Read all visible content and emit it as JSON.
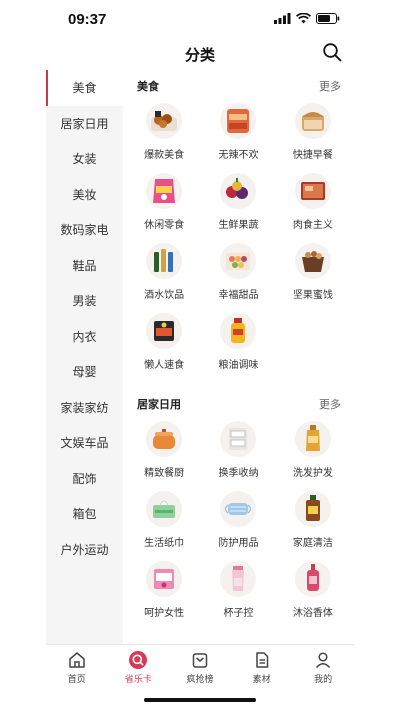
{
  "status": {
    "time": "09:37"
  },
  "header": {
    "title": "分类"
  },
  "sidebar": {
    "items": [
      {
        "label": "美食"
      },
      {
        "label": "居家日用"
      },
      {
        "label": "女装"
      },
      {
        "label": "美妆"
      },
      {
        "label": "数码家电"
      },
      {
        "label": "鞋品"
      },
      {
        "label": "男装"
      },
      {
        "label": "内衣"
      },
      {
        "label": "母婴"
      },
      {
        "label": "家装家纺"
      },
      {
        "label": "文娱车品"
      },
      {
        "label": "配饰"
      },
      {
        "label": "箱包"
      },
      {
        "label": "户外运动"
      }
    ]
  },
  "sections": [
    {
      "title": "美食",
      "more": "更多",
      "items": [
        {
          "label": "爆款美食",
          "icon": "fried-chicken-icon"
        },
        {
          "label": "无辣不欢",
          "icon": "spicy-snack-icon"
        },
        {
          "label": "快捷早餐",
          "icon": "bread-icon"
        },
        {
          "label": "休闲零食",
          "icon": "snack-bag-icon"
        },
        {
          "label": "生鲜果蔬",
          "icon": "fruit-icon"
        },
        {
          "label": "肉食主义",
          "icon": "meat-box-icon"
        },
        {
          "label": "酒水饮品",
          "icon": "bottles-icon"
        },
        {
          "label": "幸福甜品",
          "icon": "dessert-box-icon"
        },
        {
          "label": "坚果蜜饯",
          "icon": "nuts-icon"
        },
        {
          "label": "懒人速食",
          "icon": "instant-food-icon"
        },
        {
          "label": "粮油调味",
          "icon": "oil-bottle-icon"
        }
      ]
    },
    {
      "title": "居家日用",
      "more": "更多",
      "items": [
        {
          "label": "精致餐厨",
          "icon": "pot-icon"
        },
        {
          "label": "换季收纳",
          "icon": "storage-drawer-icon"
        },
        {
          "label": "洗发护发",
          "icon": "shampoo-icon"
        },
        {
          "label": "生活纸巾",
          "icon": "tissue-icon"
        },
        {
          "label": "防护用品",
          "icon": "face-mask-icon"
        },
        {
          "label": "家庭清洁",
          "icon": "cleaner-bottle-icon"
        },
        {
          "label": "呵护女性",
          "icon": "pads-icon"
        },
        {
          "label": "杯子控",
          "icon": "cup-icon"
        },
        {
          "label": "沐浴香体",
          "icon": "body-wash-icon"
        }
      ]
    }
  ],
  "tabbar": {
    "items": [
      {
        "label": "首页",
        "icon": "home-icon"
      },
      {
        "label": "省乐卡",
        "icon": "search-circle-icon"
      },
      {
        "label": "疯抢榜",
        "icon": "ranking-icon"
      },
      {
        "label": "素材",
        "icon": "document-icon"
      },
      {
        "label": "我的",
        "icon": "profile-icon"
      }
    ]
  },
  "colors": {
    "accent": "#d63a58",
    "sidebar_bg": "#f5f5f5"
  }
}
